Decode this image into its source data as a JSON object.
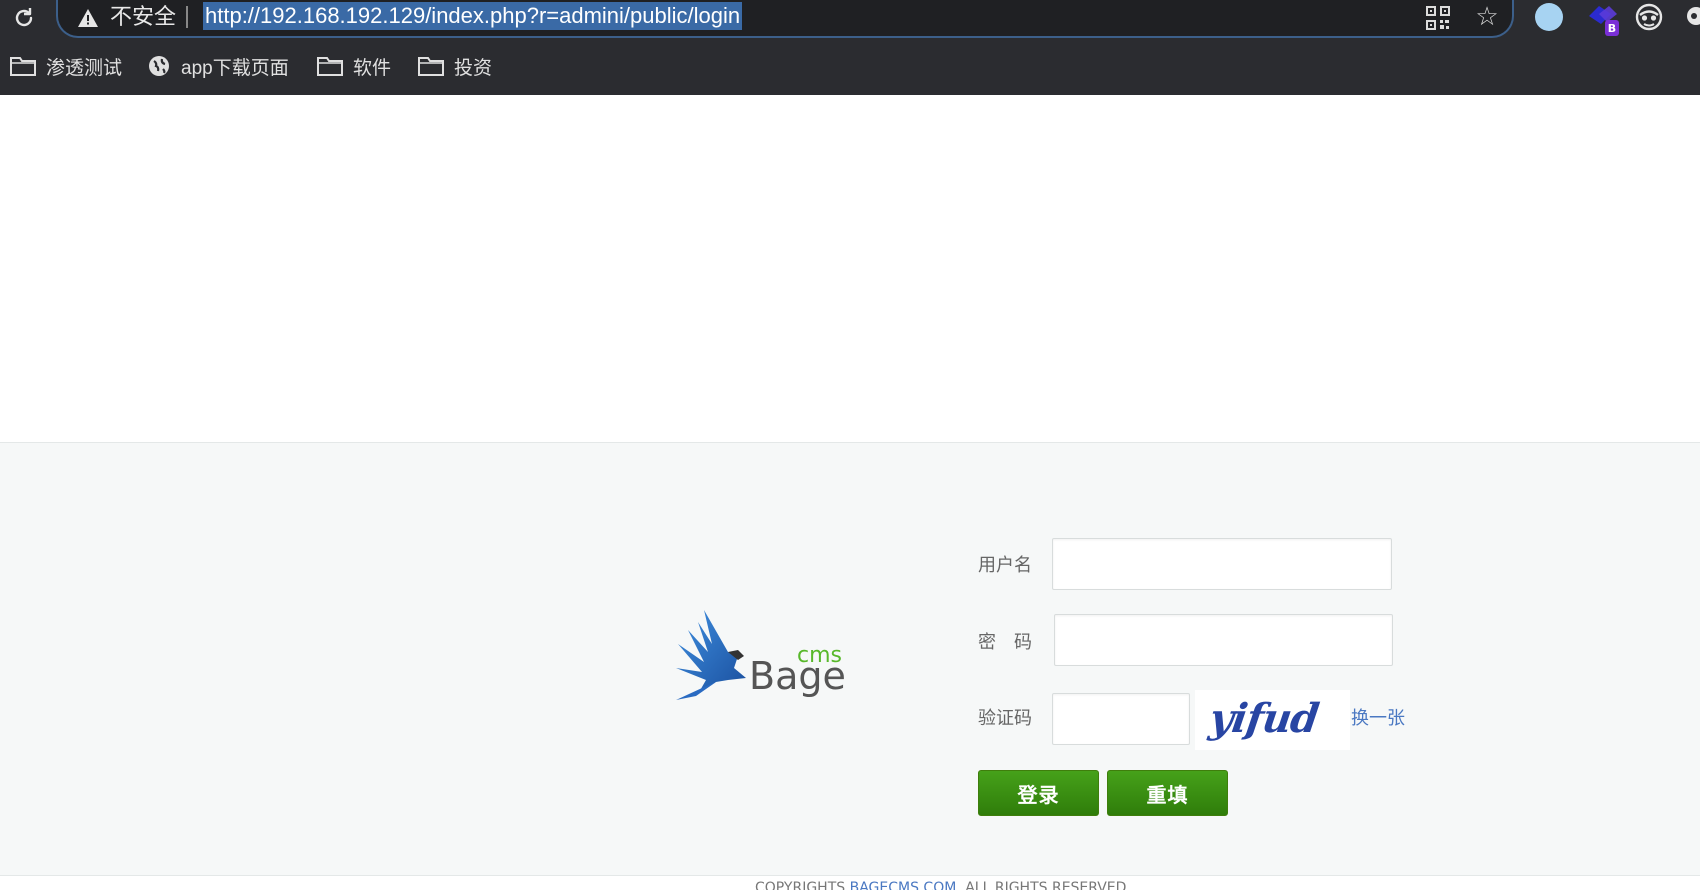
{
  "browser": {
    "security_label": "不安全",
    "url": "http://192.168.192.129/index.php?r=admini/public/login",
    "bookmarks": [
      {
        "label": "渗透测试",
        "icon": "folder-icon"
      },
      {
        "label": "app下载页面",
        "icon": "globe-icon"
      },
      {
        "label": "软件",
        "icon": "folder-icon"
      },
      {
        "label": "投资",
        "icon": "folder-icon"
      }
    ],
    "extension_badge": "B"
  },
  "logo": {
    "brand_main": "Bage",
    "brand_sub": "cms"
  },
  "form": {
    "username_label": "用户名",
    "username_value": "",
    "password_label": "密　码",
    "password_value": "",
    "captcha_label": "验证码",
    "captcha_value": "",
    "captcha_image_text": "yifud",
    "refresh_link": "换一张",
    "login_button": "登录",
    "reset_button": "重填"
  },
  "footer": {
    "prefix": "COPYRIGHTS ",
    "site": "BAGECMS.COM",
    "suffix": ". ALL RIGHTS RESERVED"
  },
  "colors": {
    "chrome_bg": "#2b2c30",
    "url_highlight": "#3a6aa6",
    "button_green": "#3d9413",
    "brand_green": "#58b82a",
    "link_blue": "#4a78c2"
  }
}
